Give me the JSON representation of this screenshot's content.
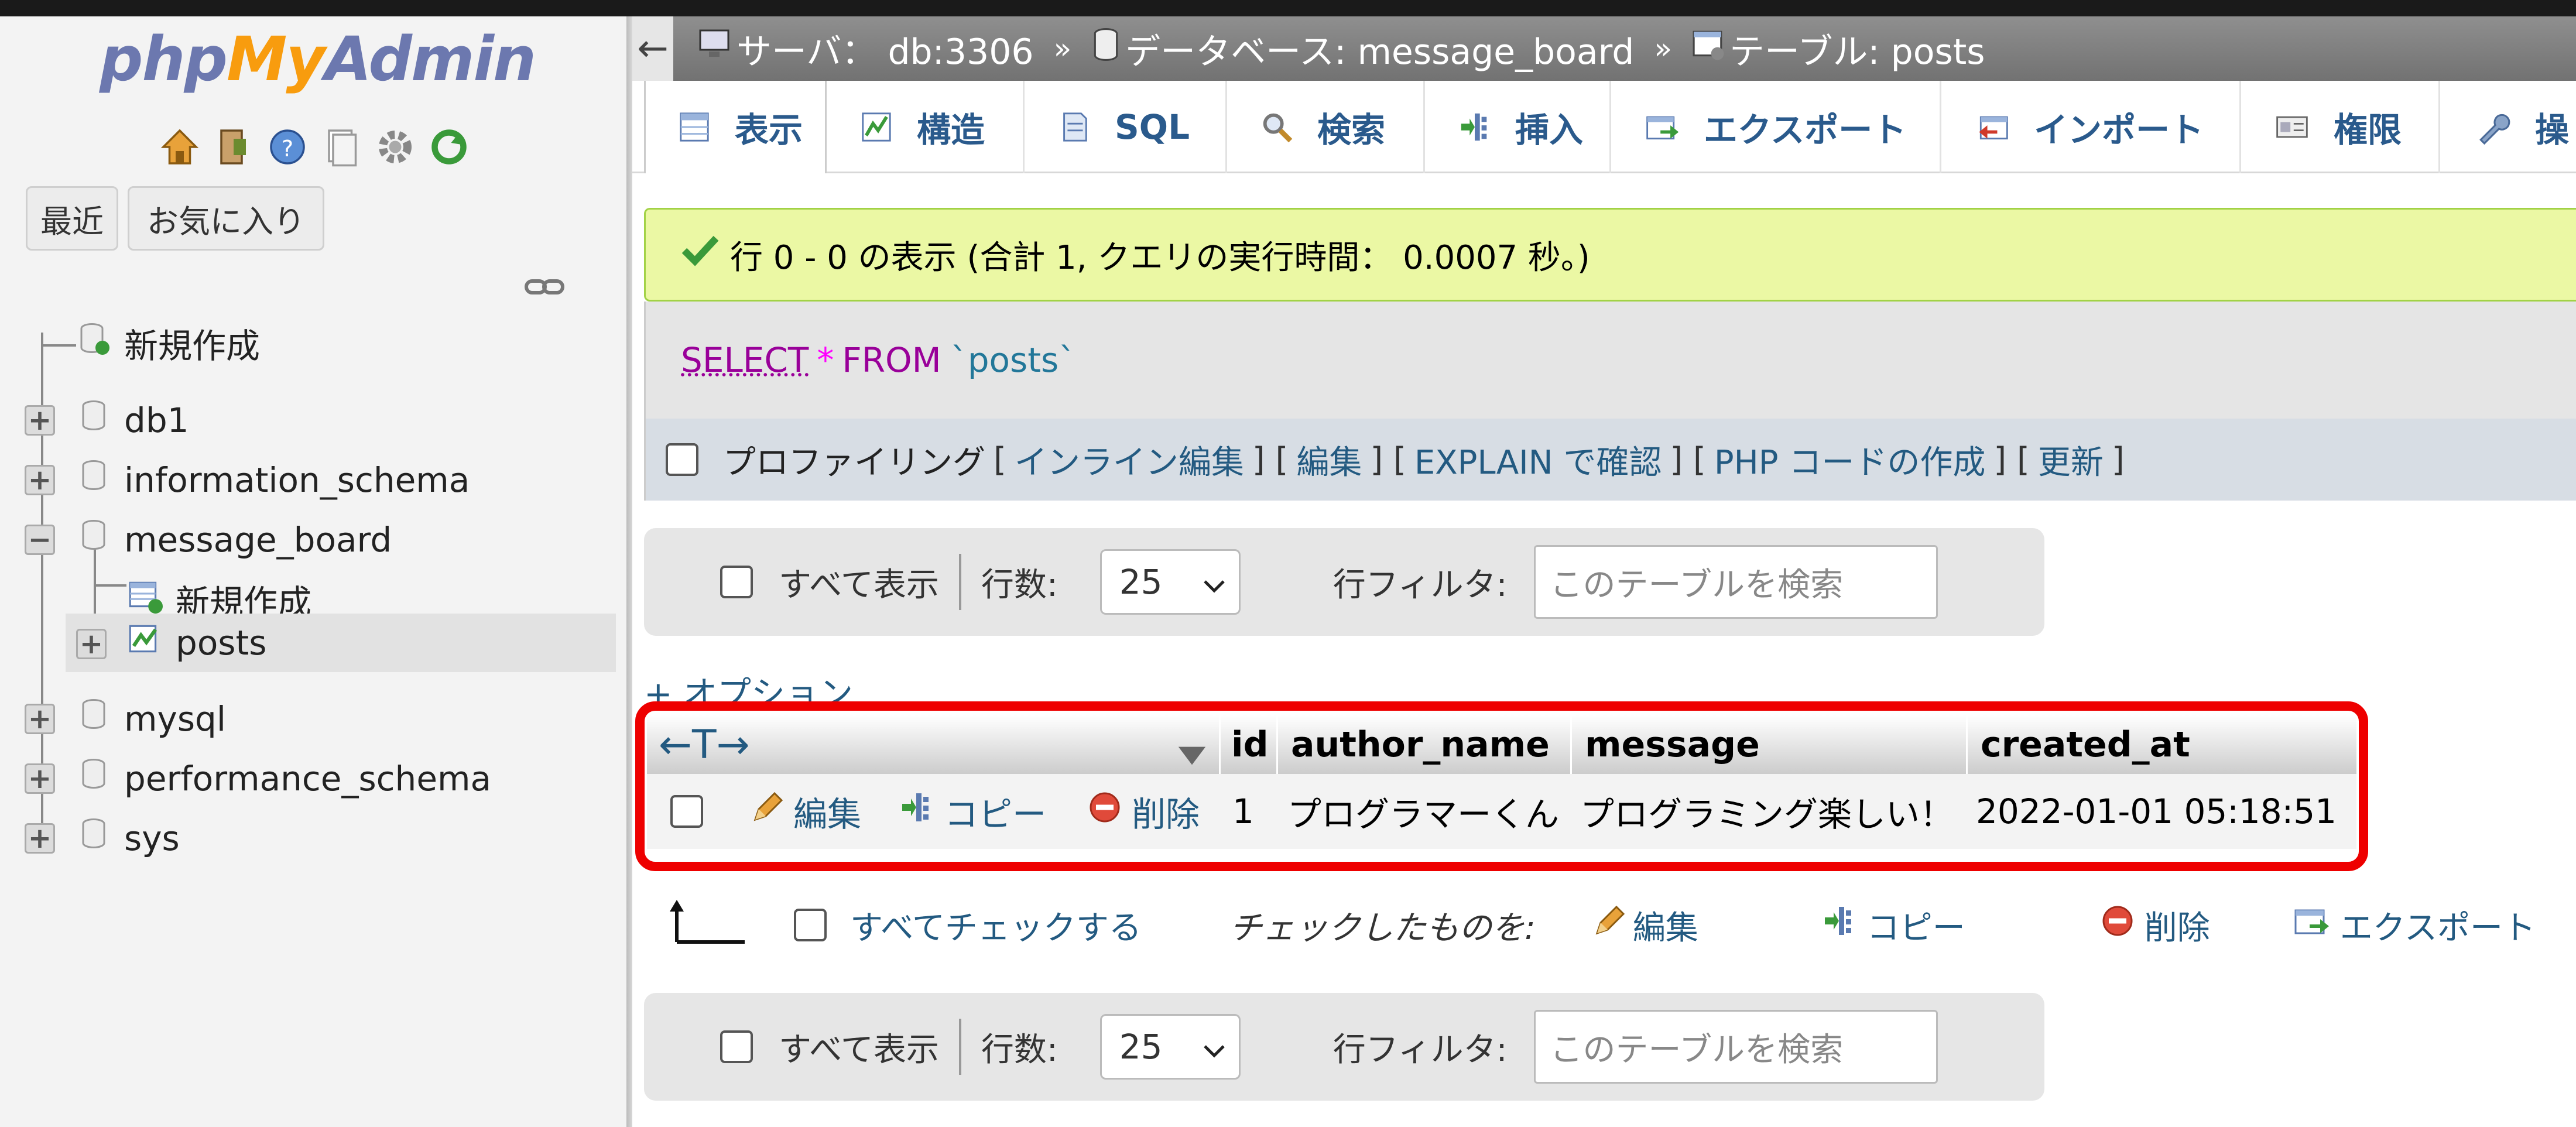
{
  "app": {
    "logo": {
      "php": "php",
      "my": "My",
      "admin": "Admin"
    },
    "sidebar_icons": [
      "home-icon",
      "exit-icon",
      "help-icon",
      "docs-icon",
      "settings-icon",
      "reload-icon"
    ]
  },
  "sidebar": {
    "recent_label": "最近",
    "favorites_label": "お気に入り",
    "tree": {
      "new": "新規作成",
      "db1": "db1",
      "information_schema": "information_schema",
      "message_board": "message_board",
      "mb_new": "新規作成",
      "posts": "posts",
      "mysql": "mysql",
      "performance_schema": "performance_schema",
      "sys": "sys"
    }
  },
  "breadcrumb": {
    "server": "サーバ： db:3306",
    "database": "データベース: message_board",
    "table": "テーブル: posts",
    "separator": "»"
  },
  "tabs": {
    "browse": "表示",
    "structure": "構造",
    "sql": "SQL",
    "search": "検索",
    "insert": "挿入",
    "export": "エクスポート",
    "import": "インポート",
    "privileges": "権限",
    "operations": "操"
  },
  "result": {
    "success_message": "行 0 - 0 の表示 (合計 1, クエリの実行時間： 0.0007 秒。)",
    "sql": {
      "select": "SELECT",
      "star": "*",
      "from": "FROM",
      "table": "`posts`"
    },
    "profiling": "プロファイリング",
    "links": {
      "inline_edit": "インライン編集",
      "edit": "編集",
      "explain": "EXPLAIN で確認",
      "php_code": "PHP コードの作成",
      "refresh": "更新"
    }
  },
  "navigation": {
    "show_all": "すべて表示",
    "rows_label": "行数:",
    "rows_value": "25",
    "filter_label": "行フィルタ:",
    "filter_placeholder": "このテーブルを検索"
  },
  "options_link": "+ オプション",
  "table": {
    "columns": [
      "id",
      "author_name",
      "message",
      "created_at"
    ],
    "rows": [
      {
        "id": "1",
        "author_name": "プログラマーくん",
        "message": "プログラミング楽しい！",
        "created_at": "2022-01-01 05:18:51"
      }
    ],
    "actions": {
      "edit": "編集",
      "copy": "コピー",
      "delete": "削除"
    },
    "arrows": "←T→"
  },
  "bulk": {
    "check_all": "すべてチェックする",
    "with_selected": "チェックしたものを:",
    "edit": "編集",
    "copy": "コピー",
    "delete": "削除",
    "export": "エクスポート"
  },
  "colors": {
    "link": "#235a81",
    "success_bg": "#ebf8a4",
    "highlight": "#ee0000"
  }
}
